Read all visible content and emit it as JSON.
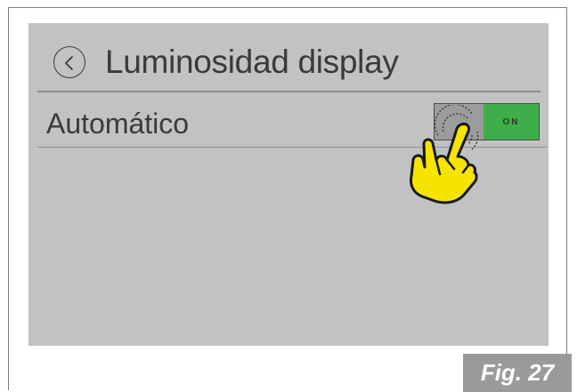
{
  "screen": {
    "title": "Luminosidad display",
    "setting": {
      "label": "Automático",
      "state": "ON"
    },
    "colors": {
      "background": "#c1c2c4",
      "toggle_on": "#3fae4a",
      "hand": "#f5e400"
    }
  },
  "figure": {
    "caption": "Fig. 27"
  }
}
